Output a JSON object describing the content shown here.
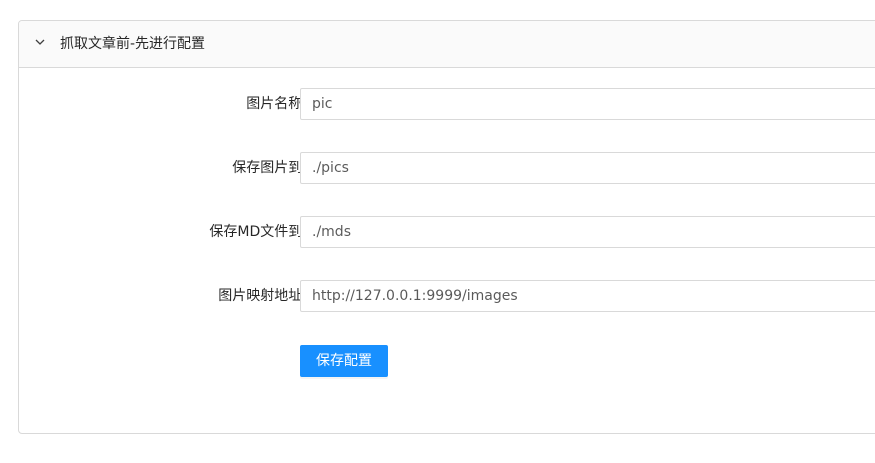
{
  "panel": {
    "title": "抓取文章前-先进行配置",
    "expanded_icon": "chevron-down-icon"
  },
  "form": {
    "fields": [
      {
        "label": "图片名称:",
        "value": "pic"
      },
      {
        "label": "保存图片到:",
        "value": "./pics"
      },
      {
        "label": "保存MD文件到:",
        "value": "./mds"
      },
      {
        "label": "图片映射地址:",
        "value": "http://127.0.0.1:9999/images"
      }
    ],
    "save_label": "保存配置"
  },
  "colors": {
    "primary": "#1890ff",
    "border": "#d9d9d9",
    "header_bg": "#fafafa"
  }
}
